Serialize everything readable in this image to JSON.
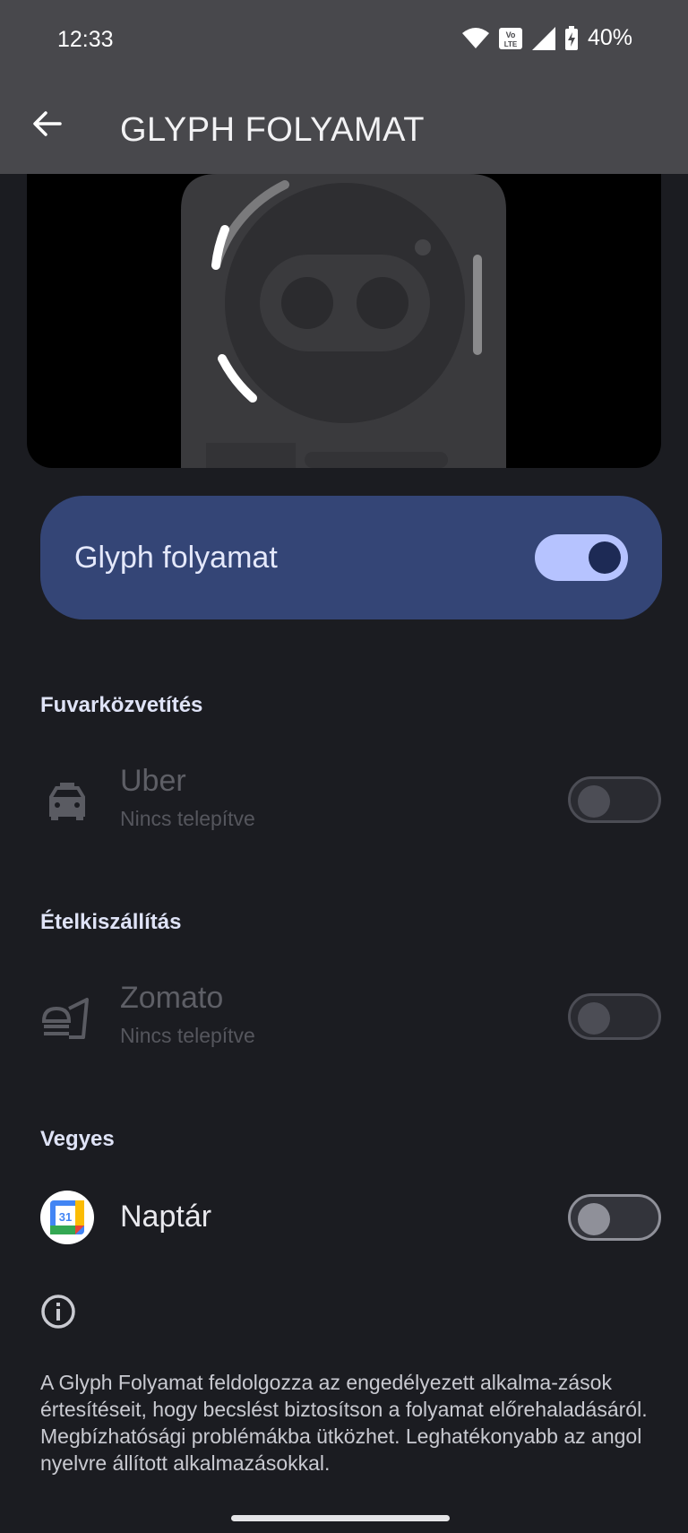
{
  "status_bar": {
    "time": "12:33",
    "battery": "40%",
    "icons": [
      "wifi-icon",
      "volte-icon",
      "signal-icon",
      "battery-charging-icon"
    ]
  },
  "app_bar": {
    "title": "GLYPH FOLYAMAT",
    "back_icon": "back-arrow-icon"
  },
  "main_toggle": {
    "label": "Glyph folyamat",
    "checked": true
  },
  "sections": {
    "ride": {
      "title": "Fuvarközvetítés",
      "app": {
        "name": "Uber",
        "status": "Nincs telepítve",
        "icon": "taxi-icon",
        "enabled": false
      }
    },
    "food": {
      "title": "Ételkiszállítás",
      "app": {
        "name": "Zomato",
        "status": "Nincs telepítve",
        "icon": "food-delivery-icon",
        "enabled": false
      }
    },
    "misc": {
      "title": "Vegyes",
      "app": {
        "name": "Naptár",
        "icon": "calendar-icon",
        "calendar_day": "31",
        "enabled": false
      }
    }
  },
  "info": {
    "icon": "info-icon",
    "text": "A Glyph Folyamat feldolgozza az engedélyezett alkalma-zások értesítéseit, hogy becslést biztosítson a folyamat előrehaladásáról. Megbízhatósági problémákba ütközhet. Leghatékonyabb az angol nyelvre állított alkalmazásokkal."
  },
  "colors": {
    "accent_card": "#344576",
    "switch_on": "#b6c3ff",
    "background": "#1b1c21",
    "topbar": "#48484c"
  }
}
